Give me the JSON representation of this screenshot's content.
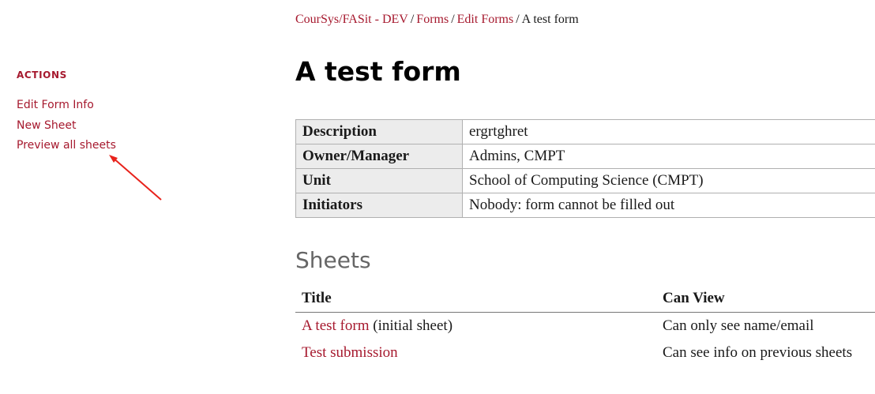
{
  "breadcrumb": {
    "items": [
      {
        "label": "CourSys/FASit - DEV"
      },
      {
        "label": "Forms"
      },
      {
        "label": "Edit Forms"
      }
    ],
    "current": "A test form",
    "separator": "/"
  },
  "sidebar": {
    "heading": "ACTIONS",
    "items": [
      {
        "label": "Edit Form Info"
      },
      {
        "label": "New Sheet"
      },
      {
        "label": "Preview all sheets"
      }
    ]
  },
  "annotation": {
    "type": "arrow",
    "color": "#e8221b",
    "points_to": "Preview all sheets"
  },
  "page": {
    "title": "A test form"
  },
  "info_table": {
    "rows": [
      {
        "label": "Description",
        "value": "ergrtghret"
      },
      {
        "label": "Owner/Manager",
        "value": "Admins, CMPT"
      },
      {
        "label": "Unit",
        "value": "School of Computing Science (CMPT)"
      },
      {
        "label": "Initiators",
        "value": "Nobody: form cannot be filled out"
      }
    ]
  },
  "sheets": {
    "heading": "Sheets",
    "columns": [
      "Title",
      "Can View"
    ],
    "rows": [
      {
        "title": "A test form",
        "note": "(initial sheet)",
        "can_view": "Can only see name/email"
      },
      {
        "title": "Test submission",
        "note": "",
        "can_view": "Can see info on previous sheets"
      }
    ]
  },
  "colors": {
    "link": "#a6192e",
    "header_bg": "#ececec",
    "section_heading": "#666666"
  }
}
